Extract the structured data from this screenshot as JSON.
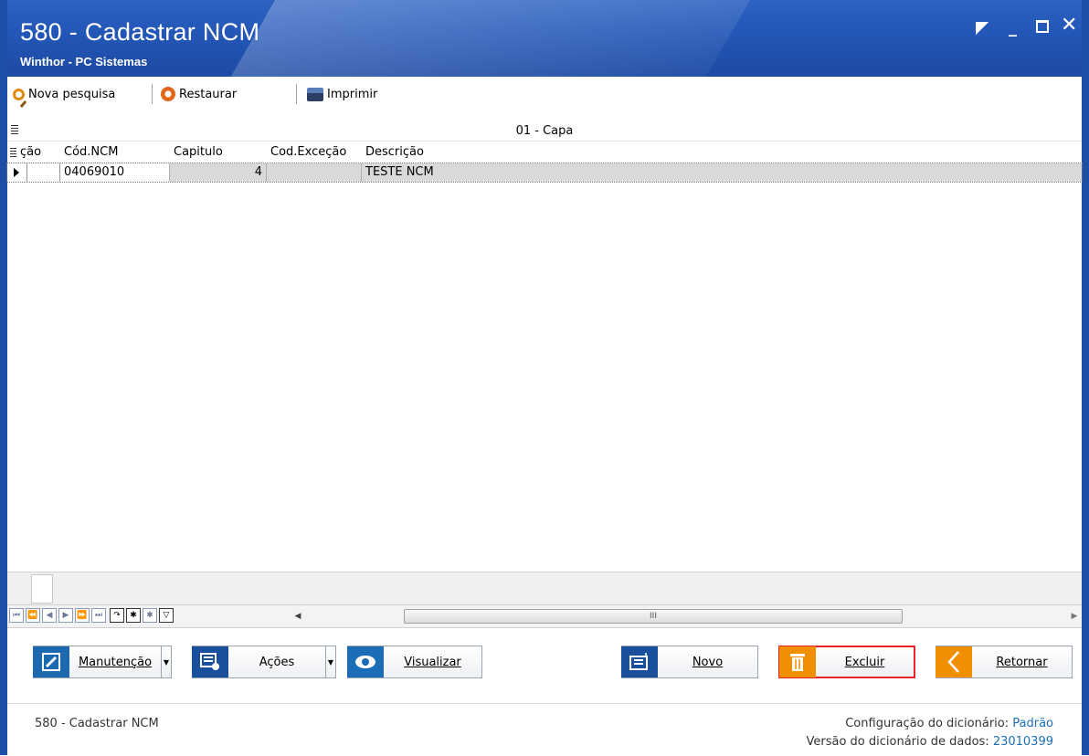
{
  "window": {
    "title": "580 - Cadastrar  NCM",
    "subtitle": "Winthor - PC Sistemas",
    "controls": {
      "restore": "",
      "minimize": "_",
      "maximize": "",
      "close": "✕"
    }
  },
  "toolbar": {
    "search_label": "Nova pesquisa",
    "restore_label": "Restaurar",
    "print_label": "Imprimir"
  },
  "grid": {
    "band_title": "01 - Capa",
    "columns": [
      "ção",
      "Cód.NCM",
      "Capitulo",
      "Cod.Exceção",
      "Descrição"
    ],
    "rows": [
      {
        "cod_ncm": "04069010",
        "capitulo": "4",
        "cod_excecao": "",
        "descricao": "TESTE NCM"
      }
    ]
  },
  "navigator": {
    "buttons": [
      "⏮",
      "⏪",
      "◀",
      "▶",
      "⏩",
      "⏭",
      "↷",
      "✱",
      "✱",
      "▽"
    ],
    "scroll_thumb": "III"
  },
  "actions": {
    "manutencao": "Manutenção",
    "acoes": "Ações",
    "visualizar": "Visualizar",
    "novo": "Novo",
    "excluir": "Excluir",
    "retornar": "Retornar"
  },
  "status": {
    "left": "580 - Cadastrar  NCM",
    "config_label": "Configuração do dicionário:",
    "config_value": "Padrão",
    "version_label": "Versão do dicionário de dados:",
    "version_value": "23010399"
  },
  "colors": {
    "titlebar": "#2457b8",
    "selected_row": "#d9d9d9",
    "excluir_border": "#e8232a"
  }
}
